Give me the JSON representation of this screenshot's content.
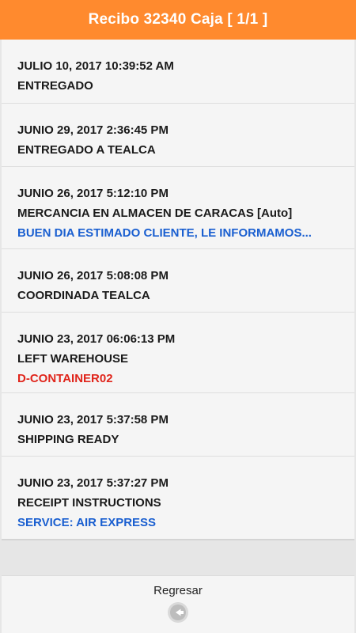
{
  "header": {
    "title": "Recibo 32340 Caja [ 1/1 ]",
    "color": "#ff8a2e"
  },
  "entries": [
    {
      "date": "JULIO 10, 2017 10:39:52 AM",
      "status": "ENTREGADO",
      "note": ""
    },
    {
      "date": "JUNIO 29, 2017 2:36:45 PM",
      "status": "ENTREGADO A TEALCA",
      "note": ""
    },
    {
      "date": "JUNIO 26, 2017 5:12:10 PM",
      "status": "MERCANCIA EN ALMACEN DE CARACAS [Auto]",
      "note": "BUEN DIA ESTIMADO CLIENTE, LE INFORMAMOS...",
      "note_color": "#1a5fd0"
    },
    {
      "date": "JUNIO 26, 2017 5:08:08 PM",
      "status": "COORDINADA TEALCA",
      "note": ""
    },
    {
      "date": "JUNIO 23, 2017 06:06:13 PM",
      "status": "LEFT WAREHOUSE",
      "note": "D-CONTAINER02",
      "note_color": "#e0251b"
    },
    {
      "date": "JUNIO 23, 2017 5:37:58 PM",
      "status": "SHIPPING READY",
      "note": ""
    },
    {
      "date": "JUNIO 23, 2017 5:37:27 PM",
      "status": "RECEIPT INSTRUCTIONS",
      "note": "SERVICE: AIR EXPRESS",
      "note_color": "#1a5fd0"
    }
  ],
  "footer": {
    "back_label": "Regresar",
    "back_icon": "back-arrow-icon"
  }
}
